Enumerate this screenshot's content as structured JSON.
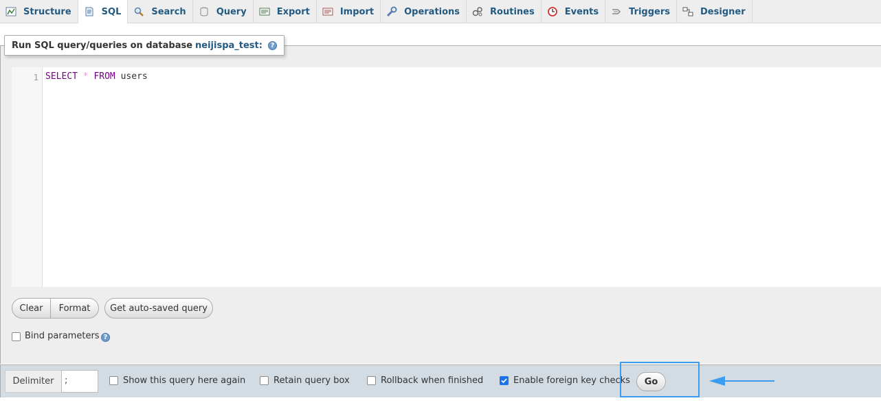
{
  "tabs": [
    {
      "label": "Structure",
      "icon": "structure-icon"
    },
    {
      "label": "SQL",
      "icon": "sql-icon",
      "active": true
    },
    {
      "label": "Search",
      "icon": "search-icon"
    },
    {
      "label": "Query",
      "icon": "query-icon"
    },
    {
      "label": "Export",
      "icon": "export-icon"
    },
    {
      "label": "Import",
      "icon": "import-icon"
    },
    {
      "label": "Operations",
      "icon": "wrench-icon"
    },
    {
      "label": "Routines",
      "icon": "routines-icon"
    },
    {
      "label": "Events",
      "icon": "clock-icon"
    },
    {
      "label": "Triggers",
      "icon": "triggers-icon"
    },
    {
      "label": "Designer",
      "icon": "designer-icon"
    }
  ],
  "legend": {
    "prefix": "Run SQL query/queries on database",
    "database": "neijispa_test:",
    "help": "?"
  },
  "editor": {
    "line_number": "1",
    "kw_select": "SELECT",
    "star": "*",
    "kw_from": "FROM",
    "table": "users"
  },
  "buttons": {
    "clear": "Clear",
    "format": "Format",
    "autosaved": "Get auto-saved query",
    "go": "Go"
  },
  "bind_parameters": {
    "label": "Bind parameters",
    "checked": false,
    "help": "?"
  },
  "bottom": {
    "delimiter_label": "Delimiter",
    "delimiter_value": ";",
    "options": [
      {
        "label": "Show this query here again",
        "checked": false
      },
      {
        "label": "Retain query box",
        "checked": false
      },
      {
        "label": "Rollback when finished",
        "checked": false
      },
      {
        "label": "Enable foreign key checks",
        "checked": true
      }
    ]
  },
  "colors": {
    "link_blue": "#235a81",
    "highlight_blue": "#3b9cf0",
    "keyword_purple": "#770088"
  }
}
